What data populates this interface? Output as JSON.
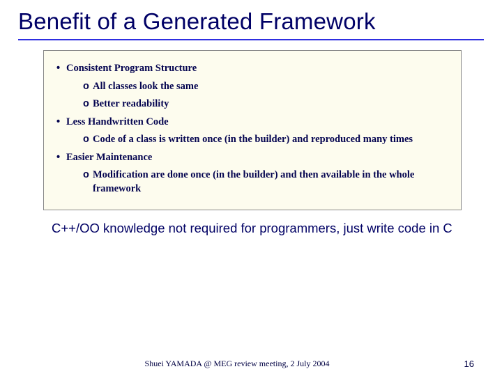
{
  "title": "Benefit of a Generated Framework",
  "bullets": {
    "b1": "Consistent Program Structure",
    "b1a": "All classes look the same",
    "b1b": "Better readability",
    "b2": "Less Handwritten Code",
    "b2a": "Code of a class is written once (in the builder) and reproduced many times",
    "b3": "Easier Maintenance",
    "b3a": "Modification are done once (in the builder) and then available in the whole framework"
  },
  "outside": "C++/OO knowledge not required for programmers, just write code in C",
  "footer": "Shuei YAMADA @ MEG review meeting, 2 July 2004",
  "page_number": "16"
}
